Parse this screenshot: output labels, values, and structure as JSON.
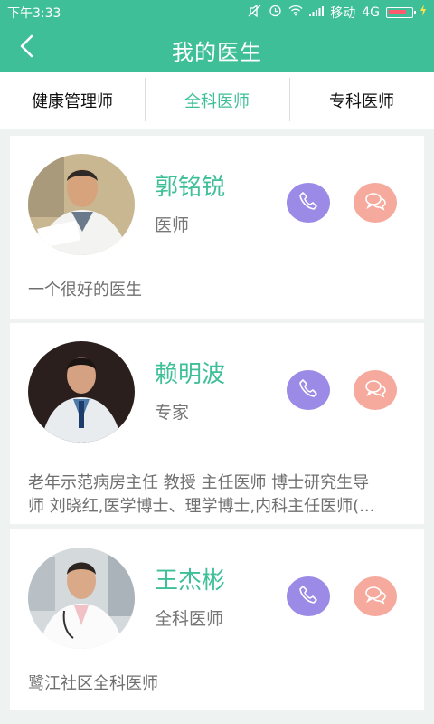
{
  "status_bar": {
    "time": "下午3:33",
    "carrier": "移动",
    "network": "4G",
    "battery_level": 0.82,
    "icons": [
      "mute-icon",
      "alarm-icon",
      "wifi-icon",
      "signal-icon",
      "battery-icon",
      "charging-icon"
    ]
  },
  "header": {
    "title": "我的医生",
    "back_icon": "chevron-left-icon",
    "color": "#3fbf98"
  },
  "tabs": [
    {
      "label": "健康管理师",
      "active": false
    },
    {
      "label": "全科医师",
      "active": true
    },
    {
      "label": "专科医师",
      "active": false
    }
  ],
  "doctors": [
    {
      "name": "郭铭锐",
      "title": "医师",
      "description": "一个很好的医生",
      "actions": [
        "phone-icon",
        "chat-icon"
      ]
    },
    {
      "name": "赖明波",
      "title": "专家",
      "description_lines": [
        "老年示范病房主任 教授 主任医师 博士研究生导",
        "师 刘晓红,医学博士、理学博士,内科主任医师(..."
      ],
      "actions": [
        "phone-icon",
        "chat-icon"
      ]
    },
    {
      "name": "王杰彬",
      "title": "全科医师",
      "description": "鹭江社区全科医师",
      "actions": [
        "phone-icon",
        "chat-icon"
      ]
    }
  ],
  "colors": {
    "accent": "#3fbf98",
    "call": "#9b8ae6",
    "chat": "#f6aa9d"
  }
}
